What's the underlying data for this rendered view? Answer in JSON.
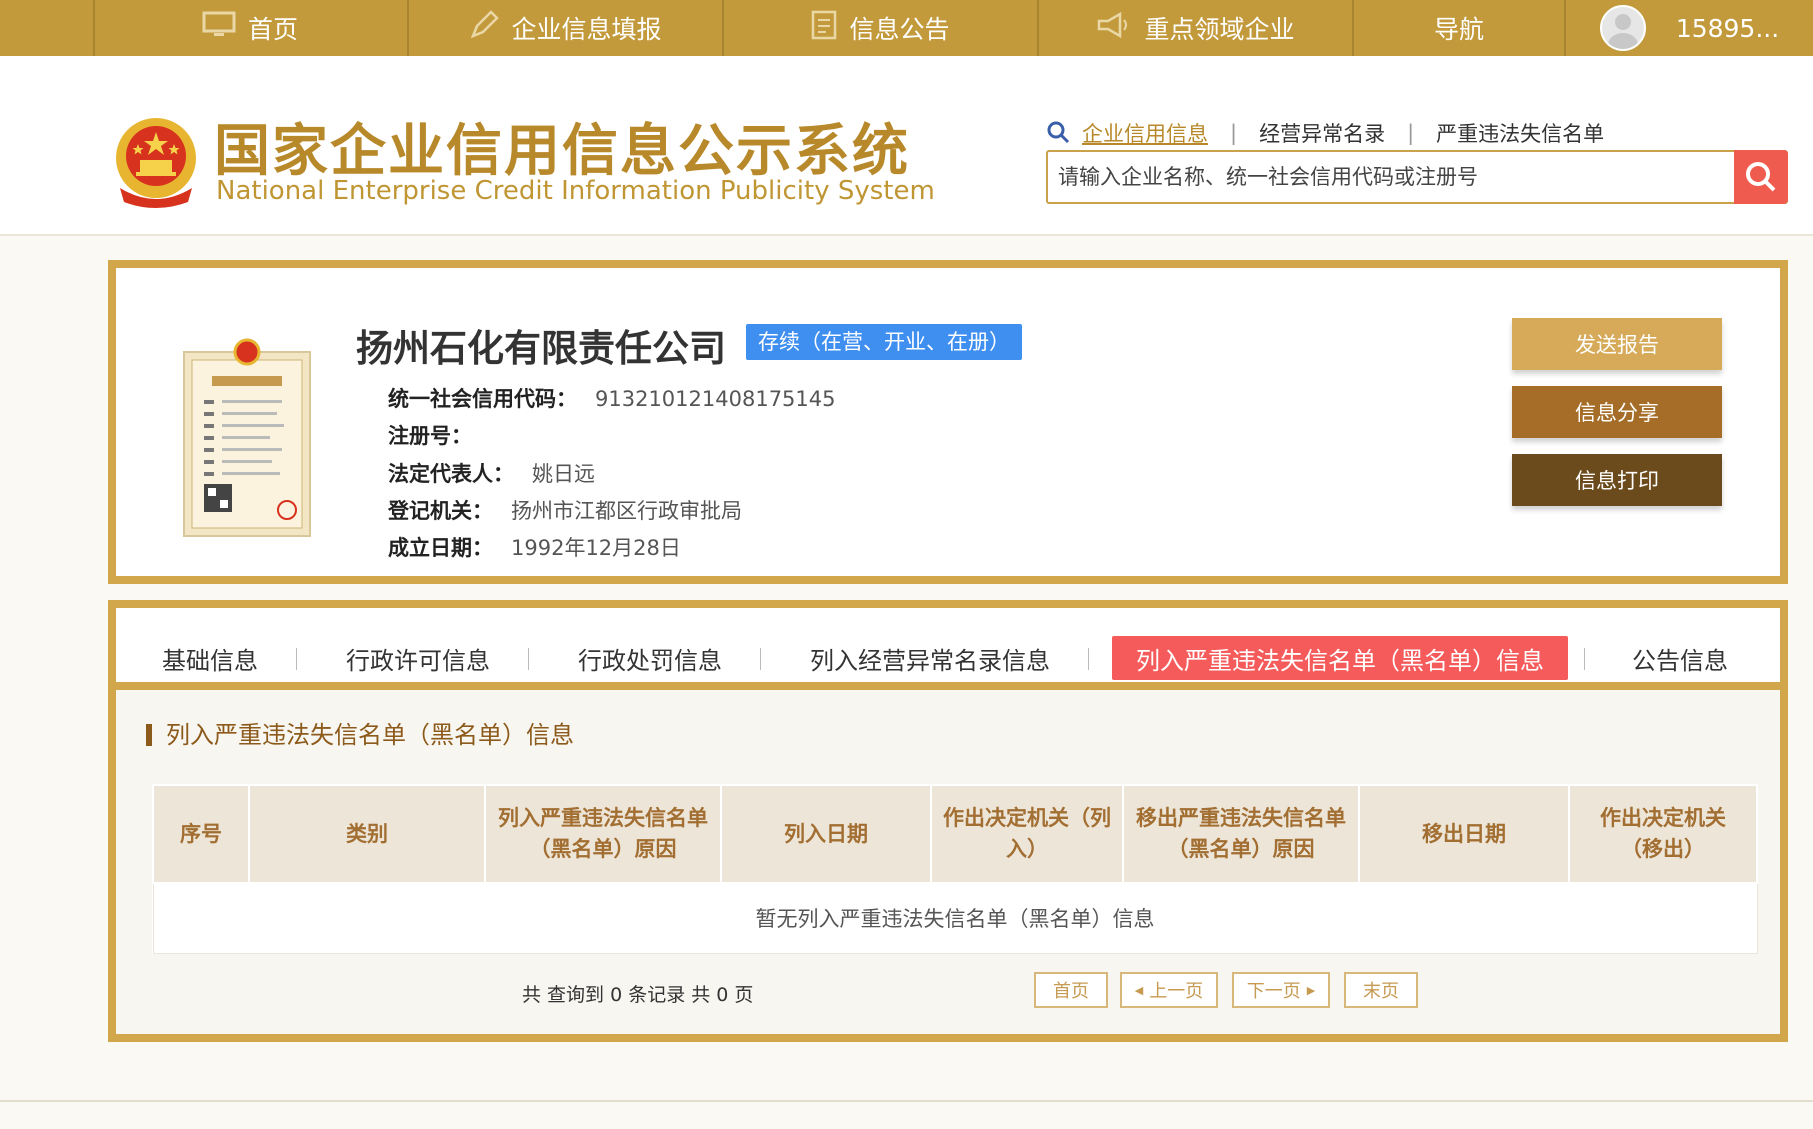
{
  "nav": {
    "items": [
      {
        "label": "首页",
        "icon": "monitor-icon"
      },
      {
        "label": "企业信息填报",
        "icon": "pen-icon"
      },
      {
        "label": "信息公告",
        "icon": "document-icon"
      },
      {
        "label": "重点领域企业",
        "icon": "megaphone-icon"
      },
      {
        "label": "导航",
        "icon": ""
      }
    ],
    "user": "15895..."
  },
  "header": {
    "title_cn": "国家企业信用信息公示系统",
    "title_en": "National Enterprise Credit Information Publicity System",
    "search_links": [
      "企业信用信息",
      "经营异常名录",
      "严重违法失信名单"
    ],
    "search_placeholder": "请输入企业名称、统一社会信用代码或注册号"
  },
  "company": {
    "name": "扬州石化有限责任公司",
    "status": "存续（在营、开业、在册）",
    "fields": [
      {
        "label": "统一社会信用代码：",
        "value": "913210121408175145"
      },
      {
        "label": "注册号：",
        "value": ""
      },
      {
        "label": "法定代表人：",
        "value": "姚日远"
      },
      {
        "label": "登记机关：",
        "value": "扬州市江都区行政审批局"
      },
      {
        "label": "成立日期：",
        "value": "1992年12月28日"
      }
    ],
    "buttons": [
      "发送报告",
      "信息分享",
      "信息打印"
    ]
  },
  "tabs": [
    "基础信息",
    "行政许可信息",
    "行政处罚信息",
    "列入经营异常名录信息",
    "列入严重违法失信名单（黑名单）信息",
    "公告信息"
  ],
  "section": {
    "title": "列入严重违法失信名单（黑名单）信息",
    "columns": [
      "序号",
      "类别",
      "列入严重违法失信名单（黑名单）原因",
      "列入日期",
      "作出决定机关（列入）",
      "移出严重违法失信名单（黑名单）原因",
      "移出日期",
      "作出决定机关（移出）"
    ],
    "empty_text": "暂无列入严重违法失信名单（黑名单）信息"
  },
  "pager": {
    "summary": "共 查询到 0 条记录 共 0 页",
    "first": "首页",
    "prev": "上一页",
    "next": "下一页",
    "last": "末页"
  },
  "colors": {
    "gold": "#c29a3c",
    "border_gold": "#d2a64a",
    "status_blue": "#3f8ff0",
    "active_tab_red": "#f55b5b",
    "search_red": "#ef5c4f"
  }
}
